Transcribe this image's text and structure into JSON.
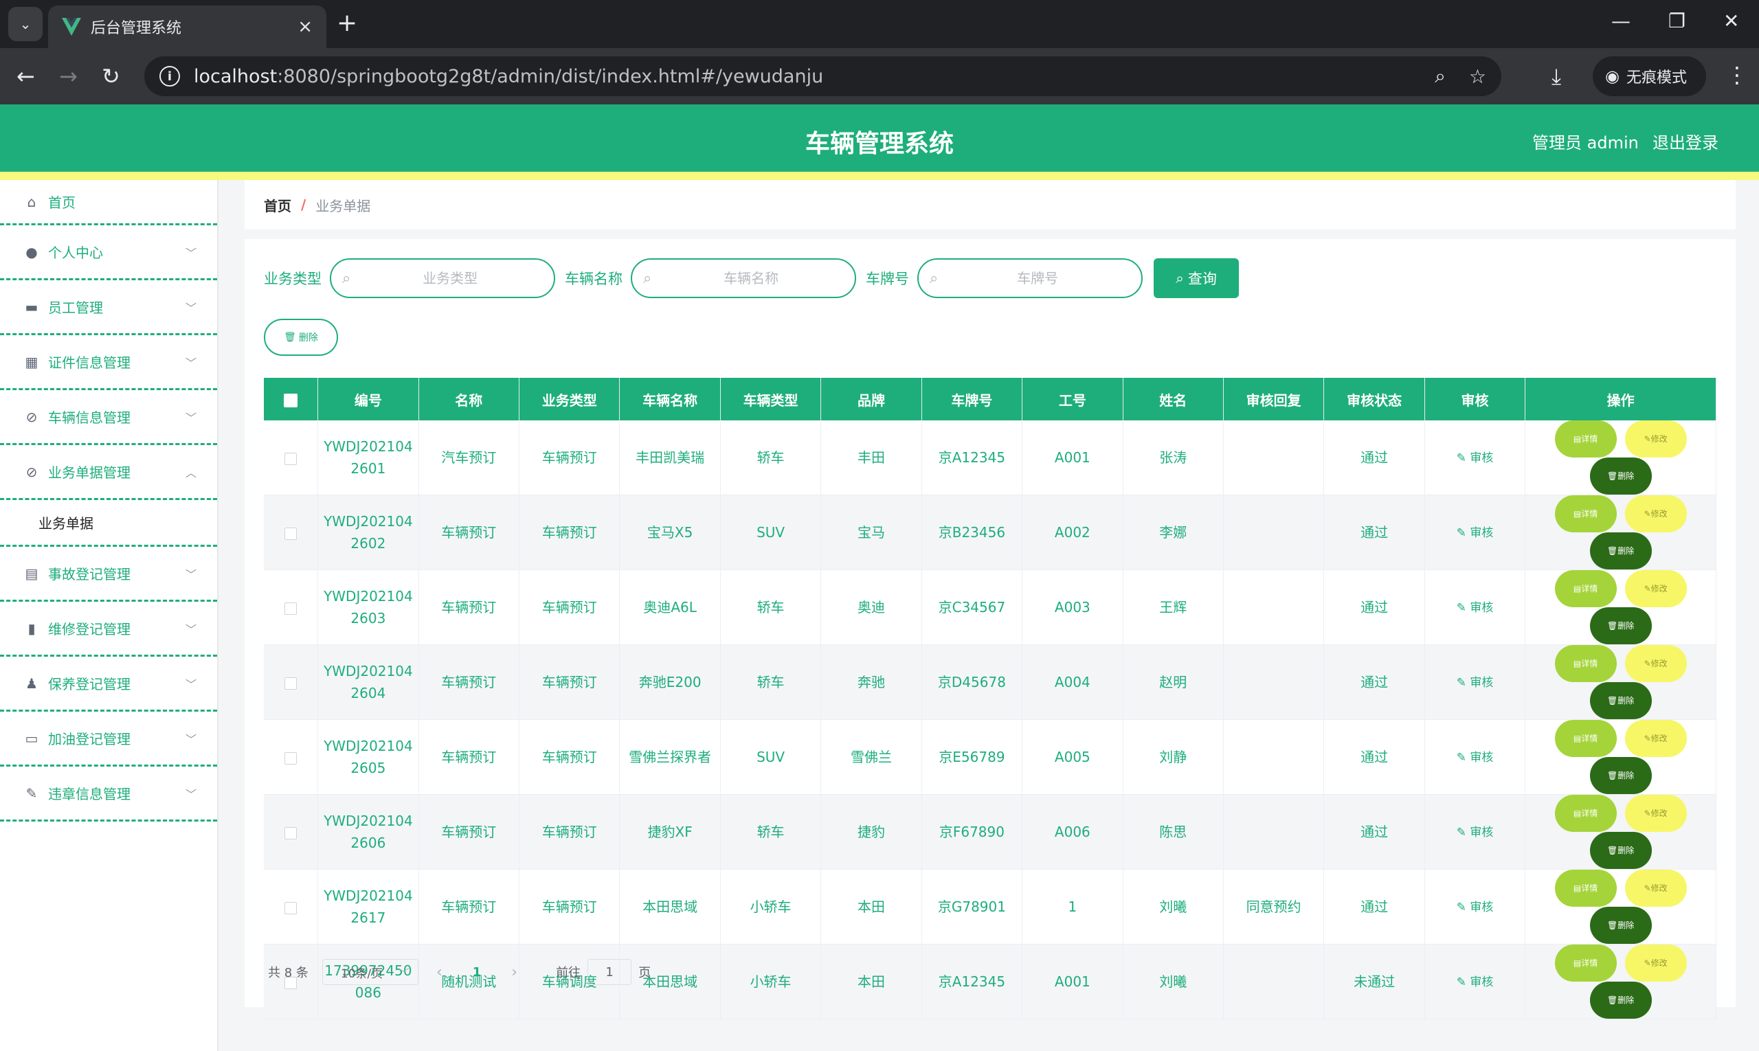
{
  "browser": {
    "tab_title": "后台管理系统",
    "url_host": "localhost",
    "url_rest": ":8080/springbootg2g8t/admin/dist/index.html#/yewudanju",
    "incognito_label": "无痕模式"
  },
  "header": {
    "title": "车辆管理系统",
    "user": "管理员 admin",
    "logout": "退出登录"
  },
  "sidebar": {
    "items": [
      {
        "label": "首页",
        "icon": "home-icon"
      },
      {
        "label": "个人中心",
        "icon": "user-icon"
      },
      {
        "label": "员工管理",
        "icon": "briefcase-icon"
      },
      {
        "label": "证件信息管理",
        "icon": "grid-icon"
      },
      {
        "label": "车辆信息管理",
        "icon": "compass-icon"
      },
      {
        "label": "业务单据管理",
        "icon": "compass-icon"
      },
      {
        "label": "事故登记管理",
        "icon": "clipboard-icon"
      },
      {
        "label": "维修登记管理",
        "icon": "bar-chart-icon"
      },
      {
        "label": "保养登记管理",
        "icon": "person-icon"
      },
      {
        "label": "加油登记管理",
        "icon": "monitor-icon"
      },
      {
        "label": "违章信息管理",
        "icon": "bell-off-icon"
      }
    ],
    "sub_item": "业务单据"
  },
  "breadcrumb": {
    "home": "首页",
    "separator": "/",
    "current": "业务单据"
  },
  "search": {
    "type_label": "业务类型",
    "type_placeholder": "业务类型",
    "vehicle_label": "车辆名称",
    "vehicle_placeholder": "车辆名称",
    "plate_label": "车牌号",
    "plate_placeholder": "车牌号",
    "query_btn": "查询",
    "batch_delete": "删除"
  },
  "table": {
    "headers": [
      "编号",
      "名称",
      "业务类型",
      "车辆名称",
      "车辆类型",
      "品牌",
      "车牌号",
      "工号",
      "姓名",
      "审核回复",
      "审核状态",
      "审核",
      "操作"
    ],
    "rows": [
      {
        "id": "YWDJ2021042601",
        "name": "汽车预订",
        "btype": "车辆预订",
        "vname": "丰田凯美瑞",
        "vtype": "轿车",
        "brand": "丰田",
        "plate": "京A12345",
        "empno": "A001",
        "person": "张涛",
        "reply": "",
        "status": "通过"
      },
      {
        "id": "YWDJ2021042602",
        "name": "车辆预订",
        "btype": "车辆预订",
        "vname": "宝马X5",
        "vtype": "SUV",
        "brand": "宝马",
        "plate": "京B23456",
        "empno": "A002",
        "person": "李娜",
        "reply": "",
        "status": "通过"
      },
      {
        "id": "YWDJ2021042603",
        "name": "车辆预订",
        "btype": "车辆预订",
        "vname": "奥迪A6L",
        "vtype": "轿车",
        "brand": "奥迪",
        "plate": "京C34567",
        "empno": "A003",
        "person": "王辉",
        "reply": "",
        "status": "通过"
      },
      {
        "id": "YWDJ2021042604",
        "name": "车辆预订",
        "btype": "车辆预订",
        "vname": "奔驰E200",
        "vtype": "轿车",
        "brand": "奔驰",
        "plate": "京D45678",
        "empno": "A004",
        "person": "赵明",
        "reply": "",
        "status": "通过"
      },
      {
        "id": "YWDJ2021042605",
        "name": "车辆预订",
        "btype": "车辆预订",
        "vname": "雪佛兰探界者",
        "vtype": "SUV",
        "brand": "雪佛兰",
        "plate": "京E56789",
        "empno": "A005",
        "person": "刘静",
        "reply": "",
        "status": "通过"
      },
      {
        "id": "YWDJ2021042606",
        "name": "车辆预订",
        "btype": "车辆预订",
        "vname": "捷豹XF",
        "vtype": "轿车",
        "brand": "捷豹",
        "plate": "京F67890",
        "empno": "A006",
        "person": "陈思",
        "reply": "",
        "status": "通过"
      },
      {
        "id": "YWDJ2021042617",
        "name": "车辆预订",
        "btype": "车辆预订",
        "vname": "本田思域",
        "vtype": "小轿车",
        "brand": "本田",
        "plate": "京G78901",
        "empno": "1",
        "person": "刘曦",
        "reply": "同意预约",
        "status": "通过"
      },
      {
        "id": "1739972450086",
        "name": "随机测试",
        "btype": "车辆调度",
        "vname": "本田思域",
        "vtype": "小轿车",
        "brand": "本田",
        "plate": "京A12345",
        "empno": "A001",
        "person": "刘曦",
        "reply": "",
        "status": "未通过"
      }
    ],
    "audit_label": "审核",
    "detail_label": "详情",
    "edit_label": "修改",
    "delete_label": "删除"
  },
  "pagination": {
    "total": "共 8 条",
    "page_size": "10条/页",
    "current_page": "1",
    "goto_label": "前往",
    "goto_value": "1",
    "page_suffix": "页"
  },
  "colors": {
    "primary": "#1eae7b",
    "stripe": "#f5fa7d",
    "detail_btn": "#a4d43a",
    "edit_btn": "#f7f666",
    "delete_btn": "#2b6b17"
  }
}
